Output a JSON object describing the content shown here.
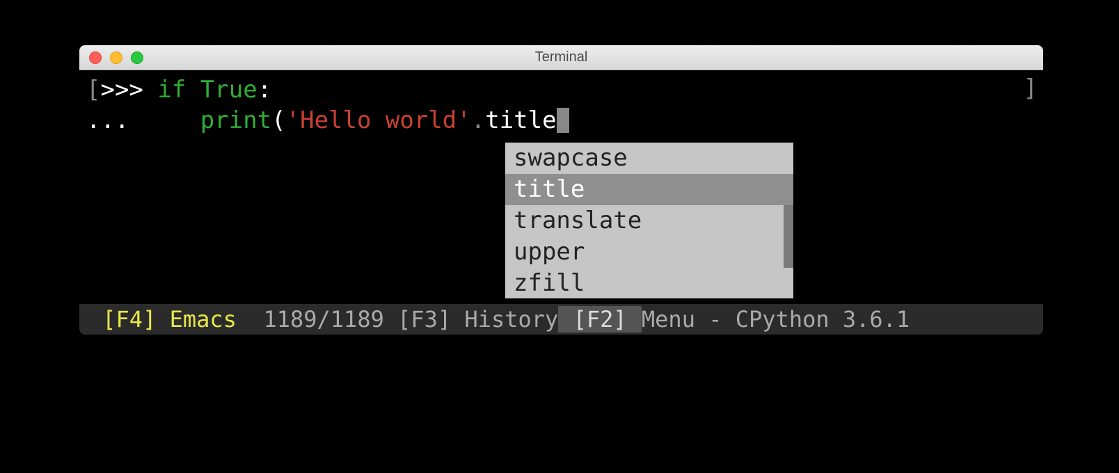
{
  "window": {
    "title": "Terminal"
  },
  "code": {
    "prompt1": ">>> ",
    "prompt2": "... ",
    "keyword": "if",
    "constant": "True",
    "colon": ":",
    "indent": "    ",
    "func": "print",
    "lparen": "(",
    "string": "'Hello world'",
    "dot": ".",
    "method": "title"
  },
  "completion": {
    "items": [
      "swapcase",
      "title",
      "translate",
      "upper",
      "zfill"
    ],
    "selected_index": 1
  },
  "statusbar": {
    "f4_key": " [F4] ",
    "f4_label": "Emacs",
    "gap1": "  ",
    "counter": "1189/1189",
    "f3_key": " [F3] ",
    "f3_label": "History",
    "f2_key": " [F2] ",
    "f2_label": "Menu",
    "tail": " - CPython 3.6.1 "
  }
}
